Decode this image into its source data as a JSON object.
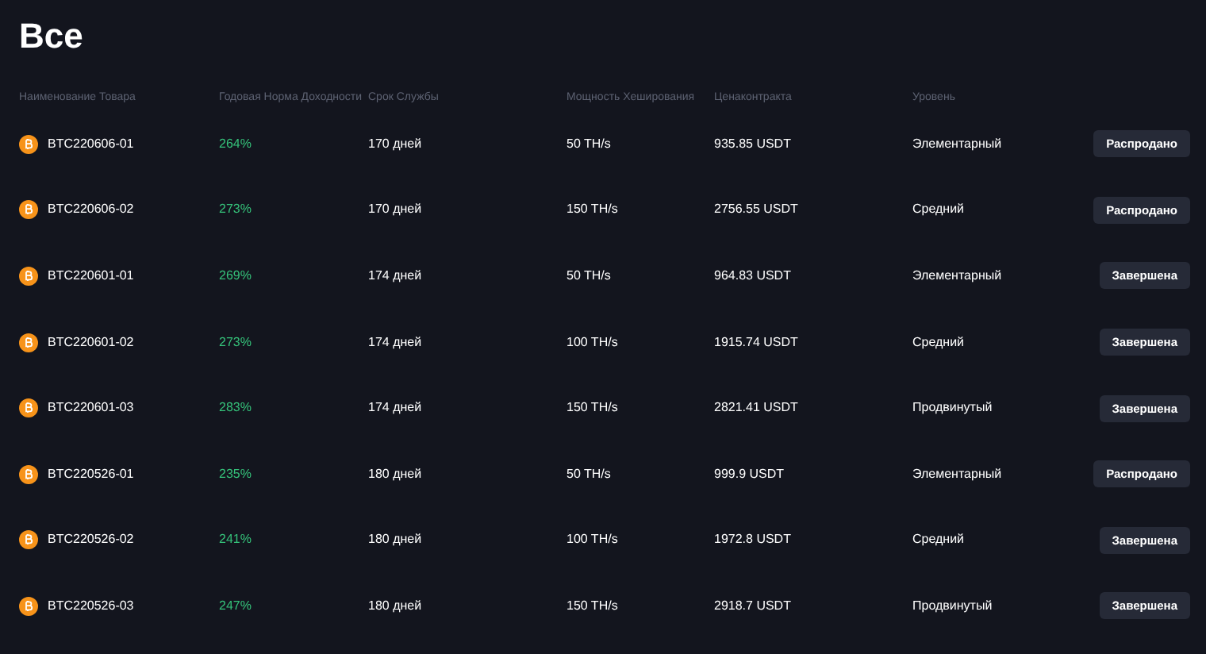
{
  "title": "Все",
  "table": {
    "columns": [
      "Наименование Товара",
      "Годовая Норма Доходности",
      "Срок Службы",
      "Мощность Хеширования",
      "Ценаконтракта",
      "Уровень"
    ],
    "rows": [
      {
        "name": "BTC220606-01",
        "yield": "264%",
        "term": "170 дней",
        "hashrate": "50 TH/s",
        "price": "935.85 USDT",
        "level": "Элементарный",
        "action": "Распродано"
      },
      {
        "name": "BTC220606-02",
        "yield": "273%",
        "term": "170 дней",
        "hashrate": "150 TH/s",
        "price": "2756.55 USDT",
        "level": "Средний",
        "action": "Распродано"
      },
      {
        "name": "BTC220601-01",
        "yield": "269%",
        "term": "174 дней",
        "hashrate": "50 TH/s",
        "price": "964.83 USDT",
        "level": "Элементарный",
        "action": "Завершена"
      },
      {
        "name": "BTC220601-02",
        "yield": "273%",
        "term": "174 дней",
        "hashrate": "100 TH/s",
        "price": "1915.74 USDT",
        "level": "Средний",
        "action": "Завершена"
      },
      {
        "name": "BTC220601-03",
        "yield": "283%",
        "term": "174 дней",
        "hashrate": "150 TH/s",
        "price": "2821.41 USDT",
        "level": "Продвинутый",
        "action": "Завершена"
      },
      {
        "name": "BTC220526-01",
        "yield": "235%",
        "term": "180 дней",
        "hashrate": "50 TH/s",
        "price": "999.9 USDT",
        "level": "Элементарный",
        "action": "Распродано"
      },
      {
        "name": "BTC220526-02",
        "yield": "241%",
        "term": "180 дней",
        "hashrate": "100 TH/s",
        "price": "1972.8 USDT",
        "level": "Средний",
        "action": "Завершена"
      },
      {
        "name": "BTC220526-03",
        "yield": "247%",
        "term": "180 дней",
        "hashrate": "150 TH/s",
        "price": "2918.7 USDT",
        "level": "Продвинутый",
        "action": "Завершена"
      }
    ]
  }
}
